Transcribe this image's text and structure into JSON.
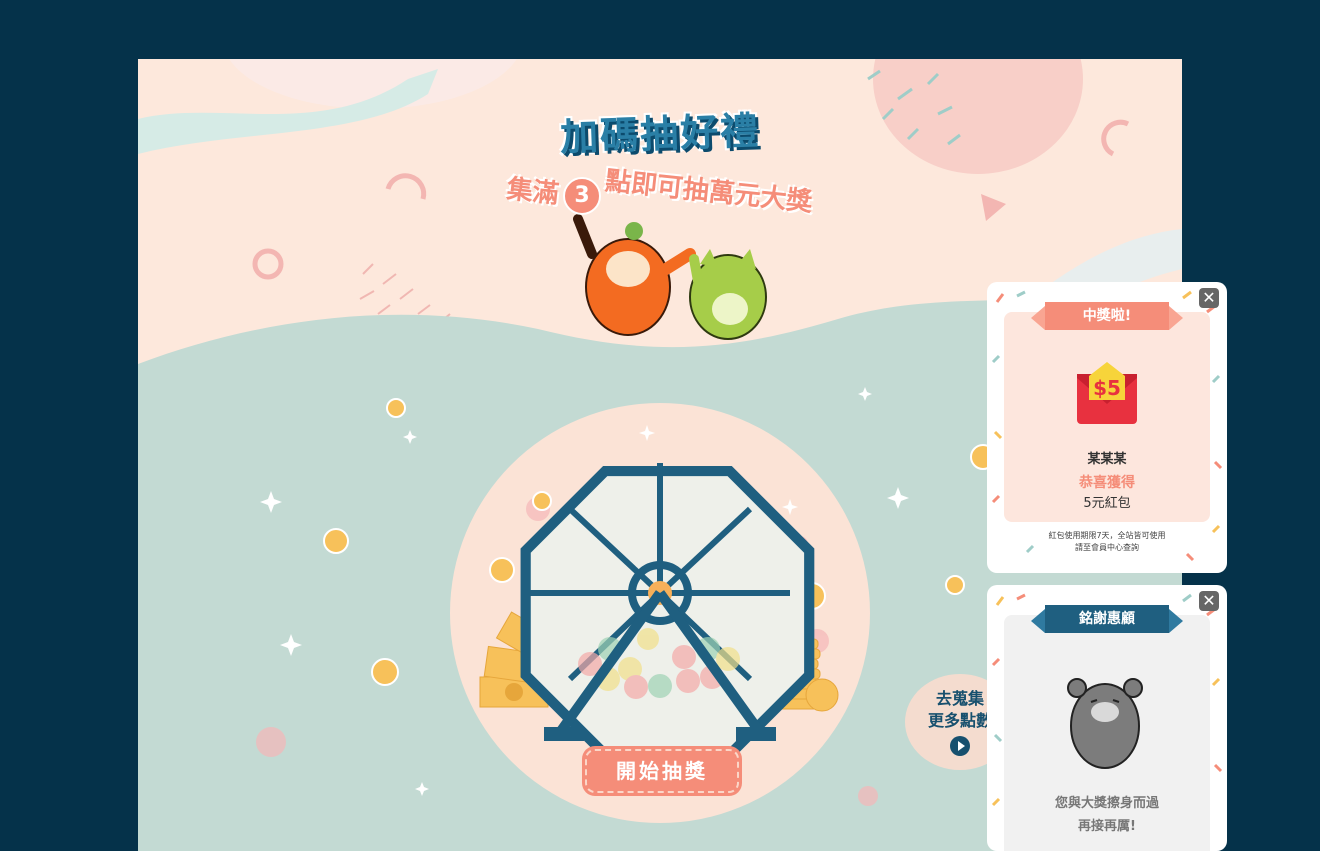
{
  "campaign": {
    "title": "加碼抽好禮",
    "subtitle_before": "集滿",
    "subtitle_number": "3",
    "subtitle_after": "點即可抽萬元大獎",
    "start_button": "開始抽獎",
    "collect_line1": "去蒐集",
    "collect_line2": "更多點數"
  },
  "win_modal": {
    "ribbon": "中獎啦!",
    "envelope_amount": "$5",
    "winner_name": "某某某",
    "congrats": "恭喜獲得",
    "prize": "5元紅包",
    "note_line1": "紅包使用期限7天，全站皆可使用",
    "note_line2": "請至會員中心查詢",
    "close_icon": "close-icon"
  },
  "lose_modal": {
    "ribbon": "銘謝惠顧",
    "message_line1": "您與大獎擦身而過",
    "message_line2": "再接再厲!",
    "close_icon": "close-icon"
  },
  "colors": {
    "background": "#05324a",
    "peach": "#fde8dc",
    "mint": "#c3dad3",
    "salmon": "#f58d79",
    "navy": "#17506e",
    "coin": "#f7c15a"
  }
}
